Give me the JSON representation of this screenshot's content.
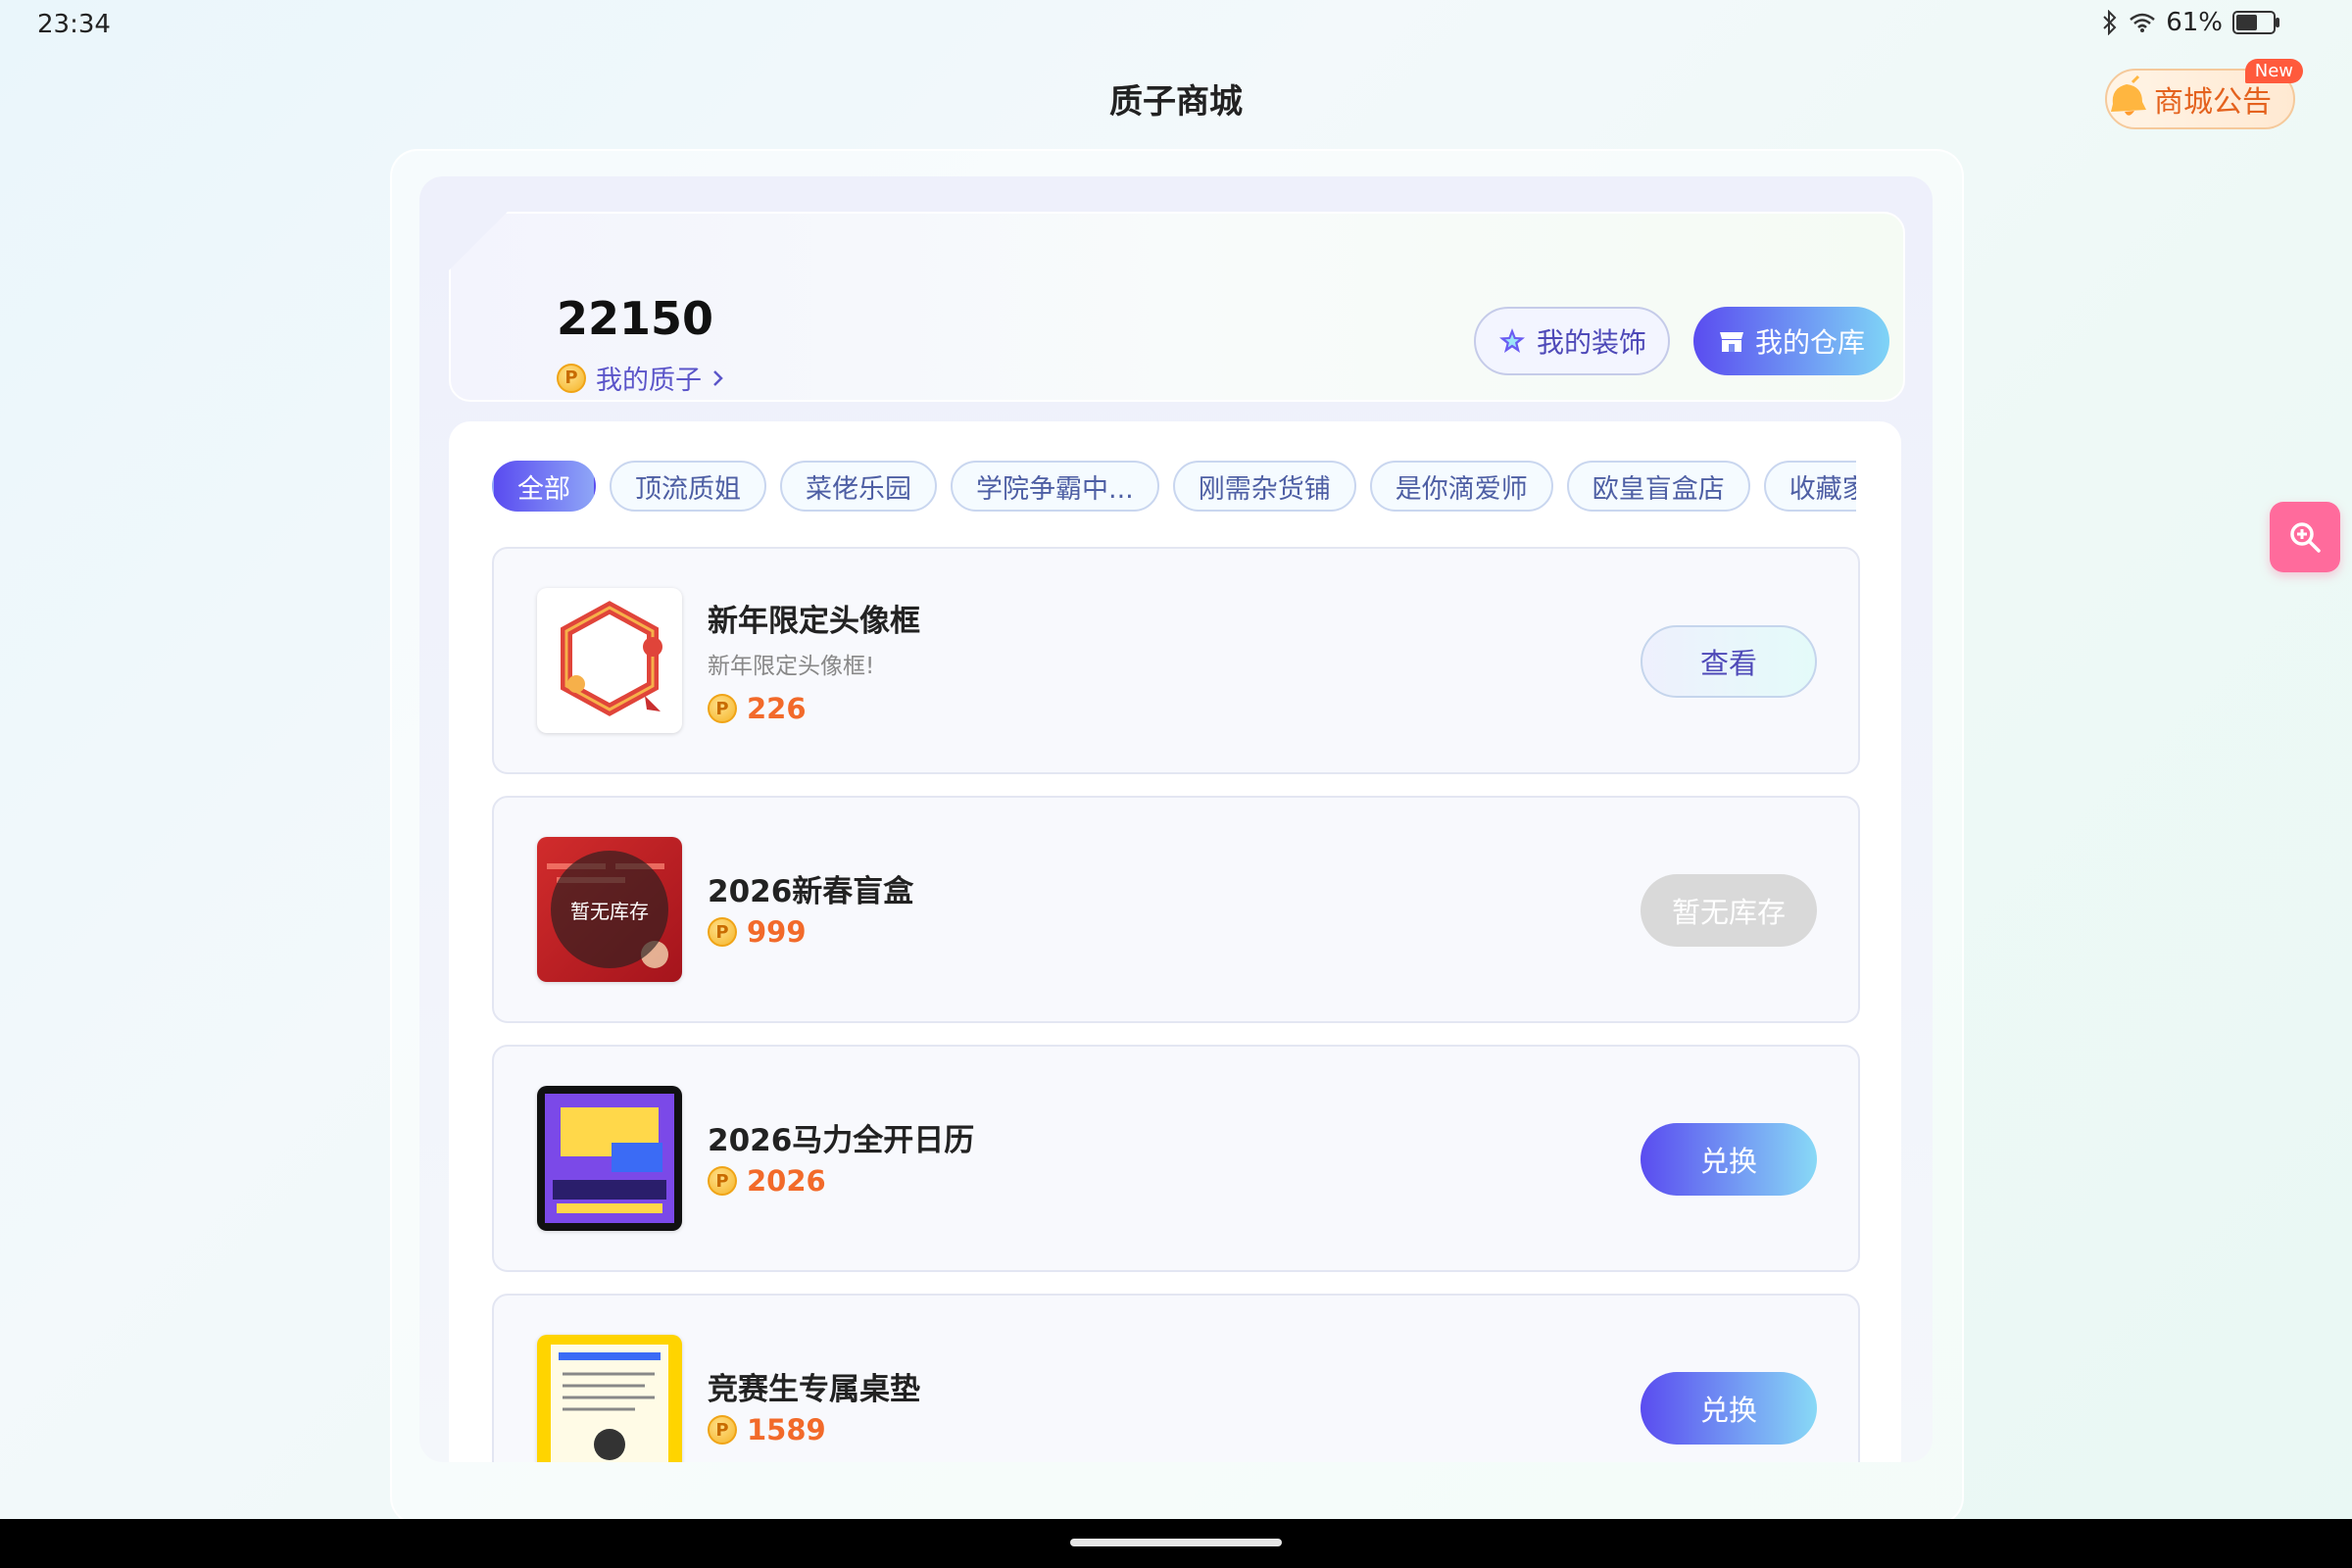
{
  "status": {
    "time": "23:34",
    "battery": "61%",
    "battery_level": 0.61
  },
  "header": {
    "title": "质子商城"
  },
  "notice": {
    "label": "商城公告",
    "badge": "New"
  },
  "wallet": {
    "balance": "22150",
    "my_points_label": "我的质子",
    "decor_button": "我的装饰",
    "storage_button": "我的仓库"
  },
  "tabs": [
    {
      "label": "全部",
      "active": true
    },
    {
      "label": "顶流质姐"
    },
    {
      "label": "菜佬乐园"
    },
    {
      "label": "学院争霸中..."
    },
    {
      "label": "刚需杂货铺"
    },
    {
      "label": "是你滴爱师"
    },
    {
      "label": "欧皇盲盒店"
    },
    {
      "label": "收藏家基"
    }
  ],
  "items": [
    {
      "name": "新年限定头像框",
      "desc": "新年限定头像框!",
      "price": "226",
      "action": "查看",
      "action_type": "view"
    },
    {
      "name": "2026新春盲盒",
      "price": "999",
      "action": "暂无库存",
      "action_type": "disabled",
      "overlay": "暂无库存"
    },
    {
      "name": "2026马力全开日历",
      "price": "2026",
      "action": "兑换",
      "action_type": "exchange"
    },
    {
      "name": "竞赛生专属桌垫",
      "price": "1589",
      "action": "兑换",
      "action_type": "exchange"
    }
  ],
  "coin_symbol": "P",
  "colors": {
    "accent": "#5a4cf0",
    "price": "#f26a2a",
    "zoom_button": "#ff6b9c"
  },
  "icons": [
    "bluetooth-icon",
    "wifi-icon",
    "battery-icon",
    "bell-icon",
    "search-zoom-icon",
    "star-decor-icon",
    "store-icon",
    "chevron-right-icon",
    "coin-icon"
  ]
}
